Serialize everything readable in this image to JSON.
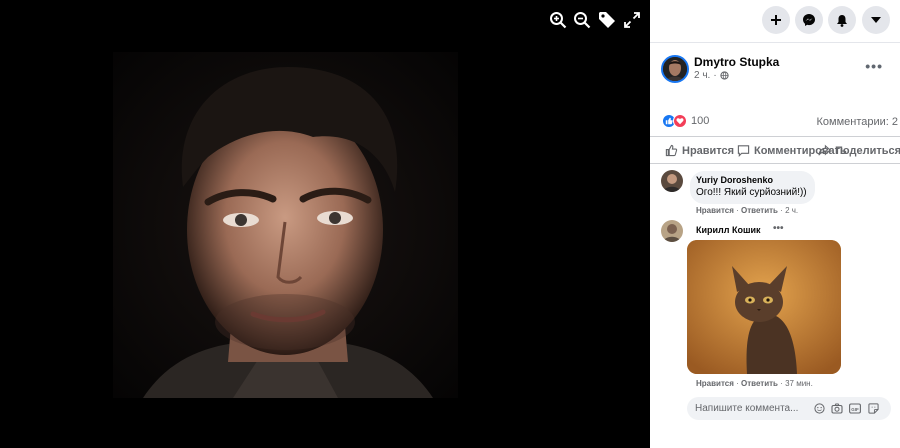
{
  "colors": {
    "accent": "#1877f2",
    "love": "#f33e58",
    "viewer_bg": "#000000"
  },
  "viewer": {
    "tools": [
      "zoom-in-icon",
      "zoom-out-icon",
      "tag-icon",
      "fullscreen-icon"
    ]
  },
  "topbar": {
    "buttons": [
      "plus-icon",
      "messenger-icon",
      "notifications-icon",
      "account-menu-icon"
    ]
  },
  "post": {
    "author": "Dmytro Stupka",
    "time": "2 ч.",
    "reactions_count": "100",
    "comments_count": "Комментарии: 2",
    "actions": {
      "like": "Нравится",
      "comment": "Комментировать",
      "share": "Поделиться"
    }
  },
  "comments": [
    {
      "author": "Yuriy Doroshenko",
      "text": "Ого!!! Який сурйозний!))",
      "like": "Нравится",
      "reply": "Ответить",
      "time": "2 ч."
    },
    {
      "author": "Кирилл Кошик",
      "like": "Нравится",
      "reply": "Ответить",
      "time": "37 мин."
    }
  ],
  "composer": {
    "placeholder": "Напишите коммента..."
  }
}
